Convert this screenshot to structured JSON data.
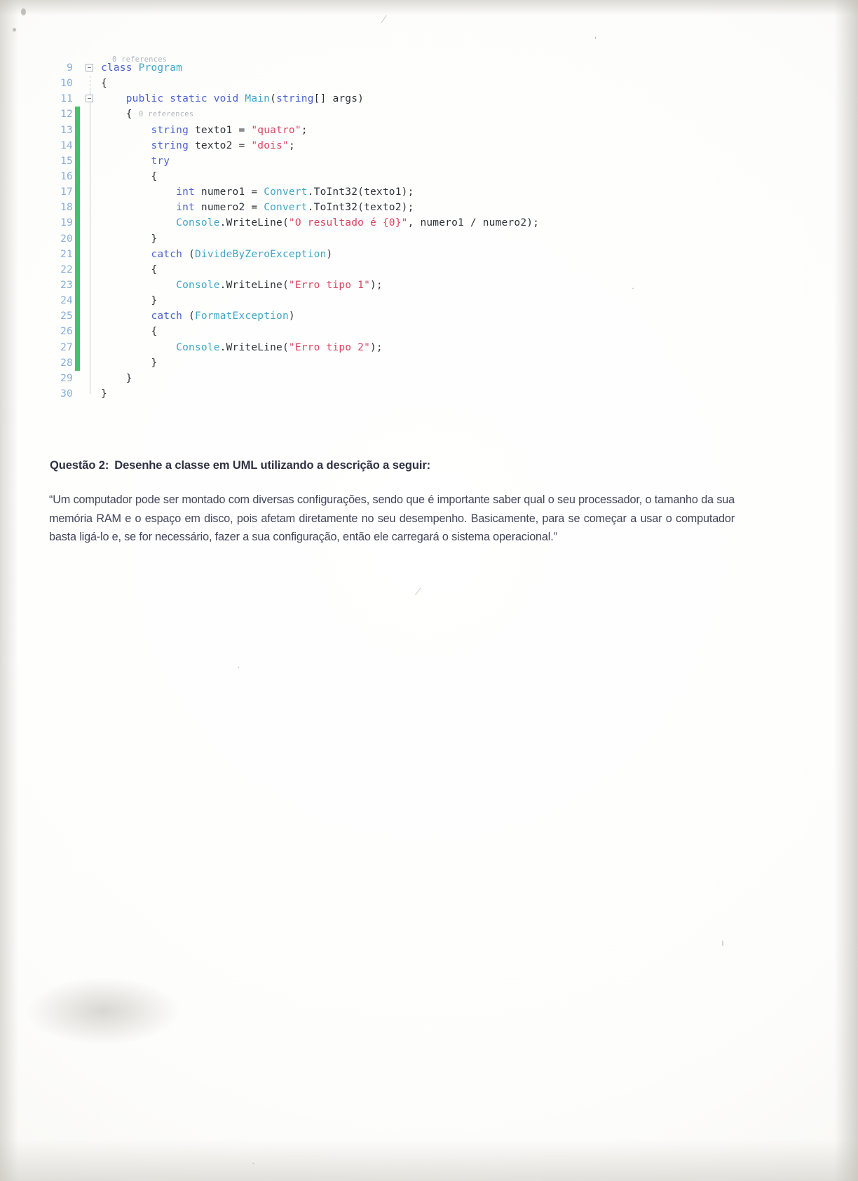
{
  "document": {
    "code_listing": {
      "language": "csharp",
      "reference_hints": [
        "0 references",
        "0 references"
      ],
      "lines": [
        {
          "number": "9",
          "changed": false,
          "collapse": true,
          "guide": "none",
          "text": "class Program",
          "tokens": [
            [
              "kw",
              "class"
            ],
            [
              "txt",
              " "
            ],
            [
              "cls",
              "Program"
            ]
          ]
        },
        {
          "number": "10",
          "changed": false,
          "collapse": false,
          "guide": "dashed",
          "text": "{",
          "tokens": [
            [
              "txt",
              "{"
            ]
          ]
        },
        {
          "number": "11",
          "changed": false,
          "collapse": true,
          "guide": "solid",
          "text": "public static void Main(string[] args)",
          "tokens": [
            [
              "kw",
              "    public static void "
            ],
            [
              "cls",
              "Main"
            ],
            [
              "txt",
              "("
            ],
            [
              "kw",
              "string"
            ],
            [
              "txt",
              "[] args)"
            ]
          ]
        },
        {
          "number": "12",
          "changed": true,
          "collapse": false,
          "guide": "solid",
          "text": "{",
          "tokens": [
            [
              "txt",
              "    {"
            ]
          ]
        },
        {
          "number": "13",
          "changed": true,
          "collapse": false,
          "guide": "solid",
          "text": "string texto1 = \"quatro\";",
          "tokens": [
            [
              "kw",
              "        string"
            ],
            [
              "txt",
              " texto1 = "
            ],
            [
              "str",
              "\"quatro\""
            ],
            [
              "txt",
              ";"
            ]
          ]
        },
        {
          "number": "14",
          "changed": true,
          "collapse": false,
          "guide": "solid",
          "text": "string texto2 = \"dois\";",
          "tokens": [
            [
              "kw",
              "        string"
            ],
            [
              "txt",
              " texto2 = "
            ],
            [
              "str",
              "\"dois\""
            ],
            [
              "txt",
              ";"
            ]
          ]
        },
        {
          "number": "15",
          "changed": true,
          "collapse": false,
          "guide": "solid",
          "text": "try",
          "tokens": [
            [
              "kw",
              "        try"
            ]
          ]
        },
        {
          "number": "16",
          "changed": true,
          "collapse": false,
          "guide": "solid",
          "text": "{",
          "tokens": [
            [
              "txt",
              "        {"
            ]
          ]
        },
        {
          "number": "17",
          "changed": true,
          "collapse": false,
          "guide": "solid",
          "text": "int numero1 = Convert.ToInt32(texto1);",
          "tokens": [
            [
              "kw",
              "            int"
            ],
            [
              "txt",
              " numero1 = "
            ],
            [
              "cls",
              "Convert"
            ],
            [
              "txt",
              ".ToInt32(texto1);"
            ]
          ]
        },
        {
          "number": "18",
          "changed": true,
          "collapse": false,
          "guide": "solid",
          "text": "int numero2 = Convert.ToInt32(texto2);",
          "tokens": [
            [
              "kw",
              "            int"
            ],
            [
              "txt",
              " numero2 = "
            ],
            [
              "cls",
              "Convert"
            ],
            [
              "txt",
              ".ToInt32(texto2);"
            ]
          ]
        },
        {
          "number": "19",
          "changed": true,
          "collapse": false,
          "guide": "solid",
          "text": "Console.WriteLine(\"O resultado é {0}\", numero1 / numero2);",
          "tokens": [
            [
              "cls",
              "            Console"
            ],
            [
              "txt",
              ".WriteLine("
            ],
            [
              "str",
              "\"O resultado é {0}\""
            ],
            [
              "txt",
              ", numero1 / numero2);"
            ]
          ]
        },
        {
          "number": "20",
          "changed": true,
          "collapse": false,
          "guide": "solid",
          "text": "}",
          "tokens": [
            [
              "txt",
              "        }"
            ]
          ]
        },
        {
          "number": "21",
          "changed": true,
          "collapse": false,
          "guide": "solid",
          "text": "catch (DivideByZeroException)",
          "tokens": [
            [
              "kw",
              "        catch"
            ],
            [
              "txt",
              " ("
            ],
            [
              "cls",
              "DivideByZeroException"
            ],
            [
              "txt",
              ")"
            ]
          ]
        },
        {
          "number": "22",
          "changed": true,
          "collapse": false,
          "guide": "solid",
          "text": "{",
          "tokens": [
            [
              "txt",
              "        {"
            ]
          ]
        },
        {
          "number": "23",
          "changed": true,
          "collapse": false,
          "guide": "solid",
          "text": "Console.WriteLine(\"Erro tipo 1\");",
          "tokens": [
            [
              "cls",
              "            Console"
            ],
            [
              "txt",
              ".WriteLine("
            ],
            [
              "str",
              "\"Erro tipo 1\""
            ],
            [
              "txt",
              ");"
            ]
          ]
        },
        {
          "number": "24",
          "changed": true,
          "collapse": false,
          "guide": "solid",
          "text": "}",
          "tokens": [
            [
              "txt",
              "        }"
            ]
          ]
        },
        {
          "number": "25",
          "changed": true,
          "collapse": false,
          "guide": "solid",
          "text": "catch (FormatException)",
          "tokens": [
            [
              "kw",
              "        catch"
            ],
            [
              "txt",
              " ("
            ],
            [
              "cls",
              "FormatException"
            ],
            [
              "txt",
              ")"
            ]
          ]
        },
        {
          "number": "26",
          "changed": true,
          "collapse": false,
          "guide": "solid",
          "text": "{",
          "tokens": [
            [
              "txt",
              "        {"
            ]
          ]
        },
        {
          "number": "27",
          "changed": true,
          "collapse": false,
          "guide": "solid",
          "text": "Console.WriteLine(\"Erro tipo 2\");",
          "tokens": [
            [
              "cls",
              "            Console"
            ],
            [
              "txt",
              ".WriteLine("
            ],
            [
              "str",
              "\"Erro tipo 2\""
            ],
            [
              "txt",
              ");"
            ]
          ]
        },
        {
          "number": "28",
          "changed": true,
          "collapse": false,
          "guide": "solid",
          "text": "}",
          "tokens": [
            [
              "txt",
              "        }"
            ]
          ]
        },
        {
          "number": "29",
          "changed": false,
          "collapse": false,
          "guide": "solid",
          "text": "}",
          "tokens": [
            [
              "txt",
              "    }"
            ]
          ]
        },
        {
          "number": "30",
          "changed": false,
          "collapse": false,
          "guide": "end",
          "text": "}",
          "tokens": [
            [
              "txt",
              "}"
            ]
          ]
        }
      ]
    },
    "question": {
      "label": "Questão 2:",
      "prompt": "Desenhe a classe em UML utilizando a descrição a seguir:",
      "body": "“Um computador pode ser montado com diversas configurações, sendo que é importante saber qual o seu processador, o tamanho da sua memória RAM e o espaço em disco, pois afetam diretamente no seu desempenho. Basicamente, para se começar a usar o computador basta ligá-lo e, se for necessário, fazer a sua configuração, então ele carregará o sistema operacional.”"
    },
    "colors": {
      "keyword": "#4b62d0",
      "class_name": "#3fa6c4",
      "string": "#d9455f",
      "line_number": "#7fa8d4",
      "change_bar": "#3fc46a",
      "body_text": "#41455a",
      "heading_text": "#2e3142"
    }
  }
}
